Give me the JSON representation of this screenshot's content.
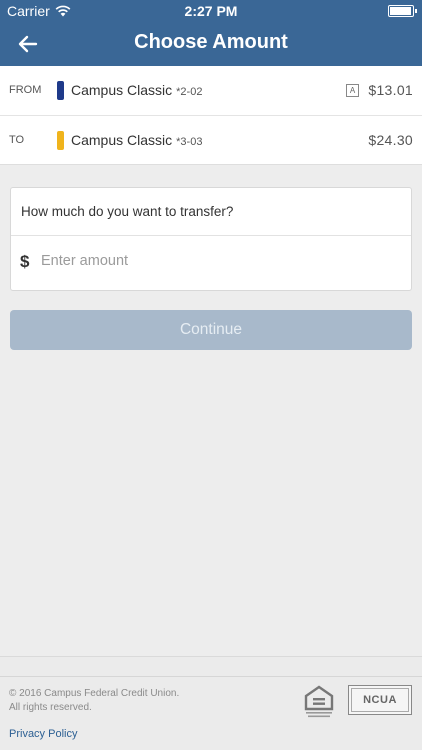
{
  "status_bar": {
    "carrier": "Carrier",
    "time": "2:27 PM"
  },
  "navbar": {
    "title": "Choose Amount",
    "back_icon": "arrow-left-icon"
  },
  "accounts": {
    "from": {
      "direction": "FROM",
      "name": "Campus Classic",
      "number": "*2-02",
      "badge": "A",
      "amount": "$13.01",
      "color": "#1f3a8a"
    },
    "to": {
      "direction": "TO",
      "name": "Campus Classic",
      "number": "*3-03",
      "amount": "$24.30",
      "color": "#f0b41c"
    }
  },
  "transfer_form": {
    "question": "How much do you want to transfer?",
    "currency_symbol": "$",
    "amount_value": "",
    "amount_placeholder": "Enter amount"
  },
  "continue_button": {
    "label": "Continue"
  },
  "footer": {
    "copyright_line1": "© 2016 Campus Federal Credit Union.",
    "copyright_line2": "All rights reserved.",
    "privacy_link": "Privacy Policy",
    "ncua_logo": "NCUA",
    "equal_housing_logo": "equal-housing-lender-icon"
  },
  "colors": {
    "brand": "#3a6796",
    "button_disabled": "#a8b9cb",
    "link": "#2c5f93"
  }
}
